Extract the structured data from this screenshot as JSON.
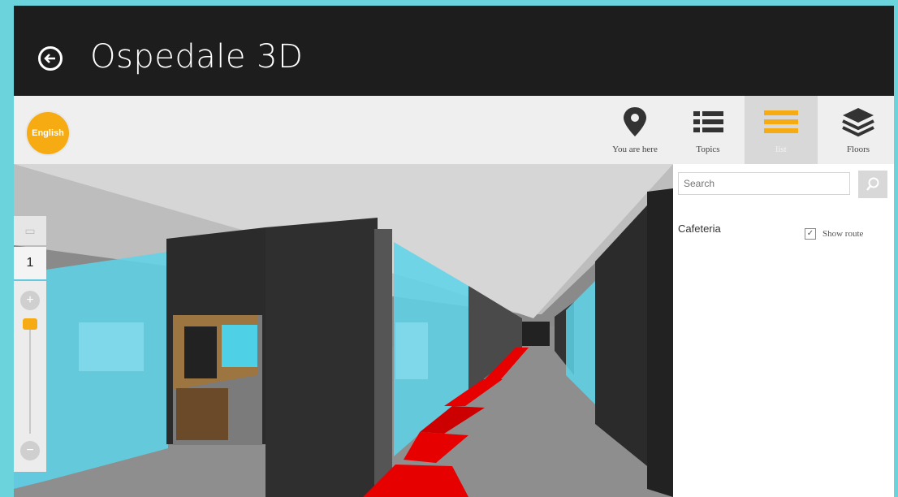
{
  "app": {
    "title": "Ospedale 3D"
  },
  "toolbar": {
    "language_button": "English",
    "buttons": [
      {
        "label": "You are here",
        "icon": "map-pin-icon"
      },
      {
        "label": "Topics",
        "icon": "list-icon"
      },
      {
        "label": "list",
        "icon": "menu-lines-icon",
        "active": true
      },
      {
        "label": "Floors",
        "icon": "layers-icon"
      }
    ]
  },
  "floor_panel": {
    "current_floor": "1",
    "zoom_in": "+",
    "zoom_out": "−"
  },
  "side_panel": {
    "search_placeholder": "Search",
    "destination": "Cafeteria",
    "show_route_label": "Show route",
    "show_route_checked": true
  },
  "colors": {
    "accent": "#f6ab13",
    "titlebar": "#1d1d1d",
    "glass": "#5ed3ea",
    "route": "#e60000"
  }
}
